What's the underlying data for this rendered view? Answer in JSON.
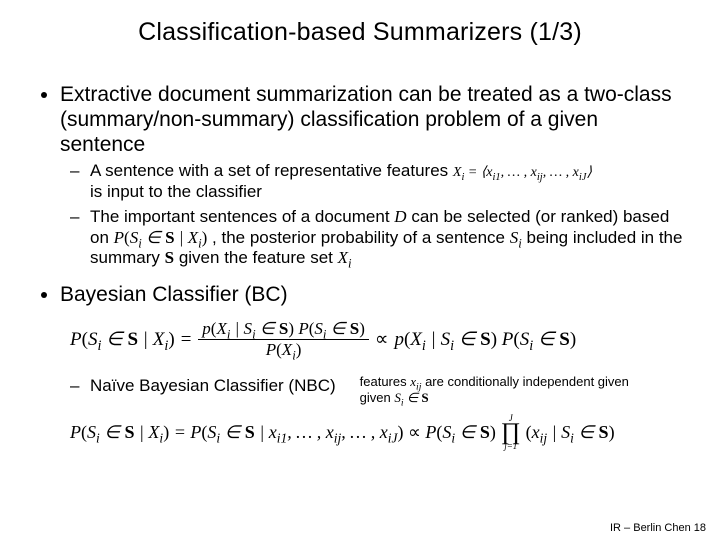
{
  "title": "Classification-based Summarizers (1/3)",
  "bullets": {
    "b1": "Extractive document summarization can be treated as a two-class (summary/non-summary) classification problem of a given sentence",
    "b1_sub1_a": "A sentence  with a set of  representative features ",
    "b1_sub1_vec": "X_i = ⟨x_{i1}, … , x_{ij}, … , x_{iJ}⟩",
    "b1_sub1_b": "is input to the classifier",
    "b1_sub2_a": "The important sentences of a document ",
    "b1_sub2_D": "D",
    "b1_sub2_b": " can be selected (or ranked) based on ",
    "b1_sub2_post": "P(S_i ∈ S | X_i)",
    "b1_sub2_c": " , the posterior probability of a sentence ",
    "b1_sub2_Si": "S_i",
    "b1_sub2_d": " being included in the summary ",
    "b1_sub2_S": "S",
    "b1_sub2_e": " given the feature set ",
    "b1_sub2_Xi": "X_i",
    "b2": "Bayesian Classifier (BC)"
  },
  "bayes": {
    "lhs": "P(S_i ∈ S | X_i) =",
    "num": "p(X_i | S_i ∈ S) P(S_i ∈ S)",
    "den": "P(X_i)",
    "prop": "∝",
    "rhs": "p(X_i | S_i ∈ S) P(S_i ∈ S)"
  },
  "nbc": {
    "label": "Naïve Bayesian Classifier (NBC)",
    "note_a": "features ",
    "note_xij": "x_{ij}",
    "note_b": " are conditionally independent given ",
    "note_cond": "S_i ∈ S"
  },
  "nbc_formula": {
    "lhs": "P(S_i ∈ S | X_i) = P(S_i ∈ S | x_{i1}, … , x_{ij}, … , x_{iJ}) ∝ P(S_i ∈ S)",
    "prod_top": "J",
    "prod_bot": "j=1",
    "term": "(x_{ij} | S_i ∈ S)"
  },
  "footer": "IR – Berlin Chen 18",
  "chart_data": {
    "type": "table",
    "title": "Classification-based Summarizers (1/3)",
    "content_outline": [
      "Extractive document summarization can be treated as a two-class (summary/non-summary) classification problem of a given sentence",
      "A sentence with a set of representative features X_i = <x_i1, ..., x_ij, ..., x_iJ> is input to the classifier",
      "The important sentences of a document D can be selected (or ranked) based on P(S_i ∈ S | X_i), the posterior probability of a sentence S_i being included in the summary S given the feature set X_i",
      "Bayesian Classifier (BC): P(S_i ∈ S | X_i) = p(X_i | S_i ∈ S) P(S_i ∈ S) / P(X_i) ∝ p(X_i | S_i ∈ S) P(S_i ∈ S)",
      "Naïve Bayesian Classifier (NBC): features x_ij are conditionally independent given S_i ∈ S",
      "P(S_i ∈ S | X_i) = P(S_i ∈ S | x_i1, ..., x_ij, ..., x_iJ) ∝ P(S_i ∈ S) ∏_{j=1}^{J} (x_ij | S_i ∈ S)"
    ],
    "footer": "IR – Berlin Chen 18"
  }
}
